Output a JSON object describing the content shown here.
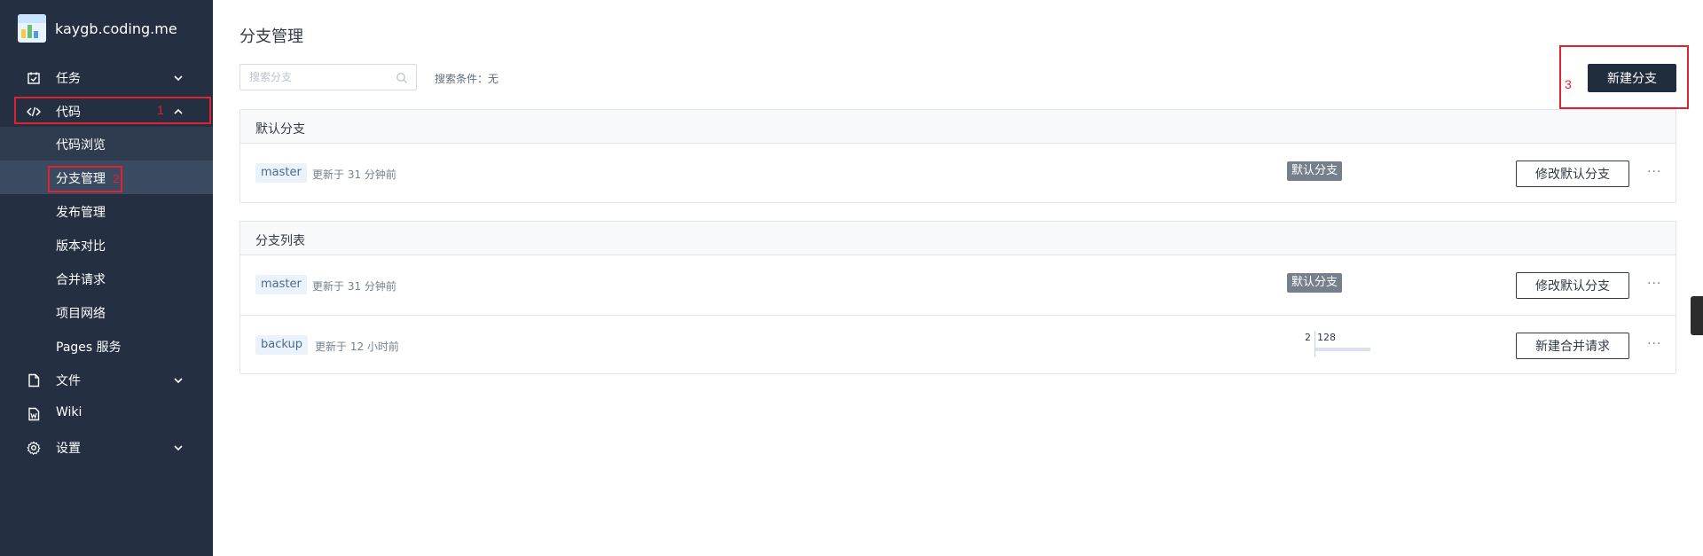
{
  "sidebar": {
    "brand": "kaygb.coding.me",
    "items": [
      {
        "label": "任务",
        "icon": "task-icon",
        "expandable": true
      },
      {
        "label": "代码",
        "icon": "code-icon",
        "expandable": true,
        "expanded": true
      },
      {
        "label": "文件",
        "icon": "file-icon",
        "expandable": true
      },
      {
        "label": "Wiki",
        "icon": "wiki-icon",
        "expandable": false
      },
      {
        "label": "设置",
        "icon": "gear-icon",
        "expandable": true
      }
    ],
    "sub_items": [
      {
        "label": "代码浏览"
      },
      {
        "label": "分支管理",
        "active": true
      },
      {
        "label": "发布管理"
      },
      {
        "label": "版本对比"
      },
      {
        "label": "合并请求"
      },
      {
        "label": "项目网络"
      },
      {
        "label": "Pages 服务"
      }
    ]
  },
  "annotations": [
    "1",
    "2",
    "3"
  ],
  "main": {
    "title": "分支管理",
    "search": {
      "placeholder": "搜索分支",
      "value": ""
    },
    "search_condition": "搜索条件：无",
    "new_branch_button": "新建分支",
    "default_section": {
      "title": "默认分支",
      "rows": [
        {
          "branch": "master",
          "updated": "更新于 31 分钟前",
          "badge": "默认分支",
          "action": "修改默认分支",
          "more": "···"
        }
      ]
    },
    "list_section": {
      "title": "分支列表",
      "rows": [
        {
          "branch": "master",
          "updated": "更新于 31 分钟前",
          "badge": "默认分支",
          "action": "修改默认分支",
          "more": "···"
        },
        {
          "branch": "backup",
          "updated": "更新于 12 小时前",
          "behind": "2",
          "ahead": "128",
          "action": "新建合并请求",
          "more": "···"
        }
      ]
    }
  },
  "colors": {
    "sidebar_bg": "#243042",
    "accent_dark": "#1f2d3d",
    "annotation_red": "#e0212f",
    "tag_bg": "#eaf3fc",
    "badge_bg": "#76808c"
  }
}
